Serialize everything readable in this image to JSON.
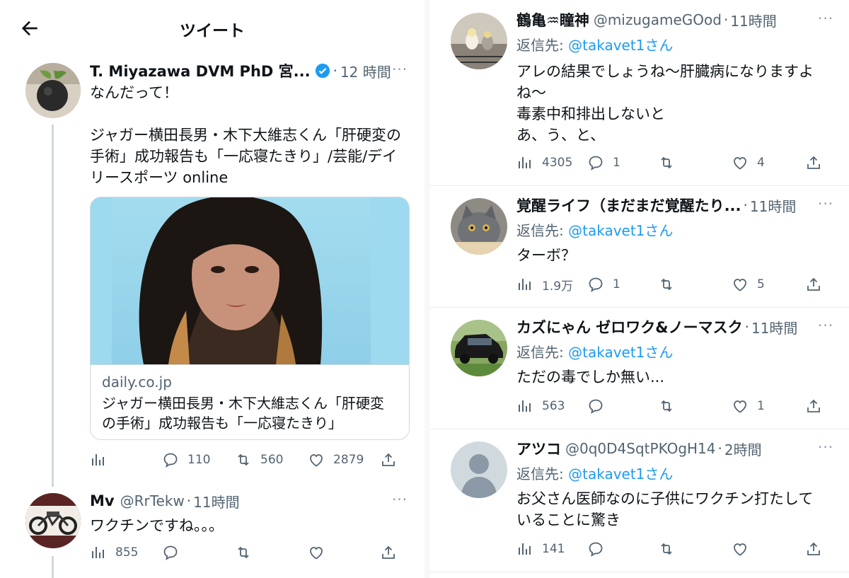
{
  "header": {
    "title": "ツイート"
  },
  "main_tweet": {
    "name": "T. Miyazawa DVM PhD 宮...",
    "time": "12 時間",
    "text": "なんだって！\n\nジャガー横田長男・木下大維志くん「肝硬変の手術」成功報告も「一応寝たきり」/芸能/デイリースポーツ online",
    "card_domain": "daily.co.jp",
    "card_title": "ジャガー横田長男・木下大維志くん「肝硬変の手術」成功報告も「一応寝たきり」",
    "replies": "110",
    "retweets": "560",
    "likes": "2879",
    "verified_color": "#1d9bf0"
  },
  "left_reply": {
    "name": "Mv",
    "handle": "@RrTekw",
    "time": "11時間",
    "text": "ワクチンですね。。。",
    "views": "855"
  },
  "replies": [
    {
      "name": "鶴亀♒瞳神",
      "handle": "@mizugameGOod",
      "time": "11時間",
      "reply_to_prefix": "返信先: ",
      "reply_to": "@takavet1さん",
      "text": "アレの結果でしょうね〜肝臓病になりますよね〜\n毒素中和排出しないと\nあ、う、と、",
      "views": "4305",
      "replies": "1",
      "retweets": "",
      "likes": "4"
    },
    {
      "name": "覚醒ライフ（まだまだ覚醒たり...",
      "handle": "",
      "time": "11時間",
      "reply_to_prefix": "返信先: ",
      "reply_to": "@takavet1さん",
      "text": "ターボ？",
      "views": "1.9万",
      "replies": "1",
      "retweets": "",
      "likes": "5"
    },
    {
      "name": "カズにゃん ゼロワク&ノーマスク",
      "handle": "",
      "time": "11時間",
      "reply_to_prefix": "返信先: ",
      "reply_to": "@takavet1さん",
      "text": "ただの毒でしか無い...",
      "views": "563",
      "replies": "",
      "retweets": "",
      "likes": "1"
    },
    {
      "name": "アツコ",
      "handle": "@0q0D4SqtPKOgH14",
      "time": "2時間",
      "reply_to_prefix": "返信先: ",
      "reply_to": "@takavet1さん",
      "text": "お父さん医師なのに子供にワクチン打たしていることに驚き",
      "views": "141",
      "replies": "",
      "retweets": "",
      "likes": ""
    }
  ],
  "icons": {
    "back": "arrow-left-icon",
    "more": "more-dots-icon",
    "views": "bar-chart-icon",
    "reply": "speech-bubble-icon",
    "retweet": "retweet-icon",
    "like": "heart-icon",
    "share": "share-icon"
  }
}
